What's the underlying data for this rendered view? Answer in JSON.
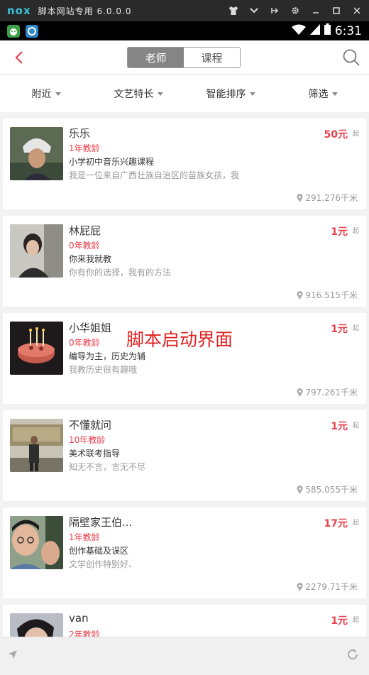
{
  "emulator": {
    "logo": "nox",
    "title": "脚本网站专用 6.0.0.0",
    "controls": [
      "shirt-icon",
      "chevron-down-icon",
      "pin-icon",
      "gear-icon",
      "minimize-icon",
      "maximize-icon",
      "close-icon"
    ]
  },
  "status_bar": {
    "time": "6:31"
  },
  "header": {
    "tabs": [
      {
        "label": "老师",
        "active": true
      },
      {
        "label": "课程",
        "active": false
      }
    ]
  },
  "filters": [
    {
      "label": "附近"
    },
    {
      "label": "文艺特长"
    },
    {
      "label": "智能排序"
    },
    {
      "label": "筛选"
    }
  ],
  "teachers": [
    {
      "name": "乐乐",
      "years": "1年教龄",
      "course": "小学初中音乐兴趣课程",
      "desc": "我是一位来自广西壮族自治区的苗族女孩，我",
      "price": "50元",
      "suffix": "起",
      "distance": "291.276千米"
    },
    {
      "name": "林屁屁",
      "years": "0年教龄",
      "course": "你来我就教",
      "desc": "你有你的选择，我有的方法",
      "price": "1元",
      "suffix": "起",
      "distance": "916.515千米"
    },
    {
      "name": "小华姐姐",
      "years": "0年教龄",
      "course": "编导为主，历史为辅",
      "desc": "我教历史很有趣哦",
      "price": "1元",
      "suffix": "起",
      "distance": "797.261千米"
    },
    {
      "name": "不懂就问",
      "years": "10年教龄",
      "course": "美术联考指导",
      "desc": "知无不言，言无不尽",
      "price": "1元",
      "suffix": "起",
      "distance": "585.055千米"
    },
    {
      "name": "隔壁家王伯...",
      "years": "1年教龄",
      "course": "创作基础及误区",
      "desc": "文学创作特别好、",
      "price": "17元",
      "suffix": "起",
      "distance": "2279.71千米"
    },
    {
      "name": "van",
      "years": "2年教龄",
      "course": "",
      "desc": "",
      "price": "1元",
      "suffix": "起",
      "distance": ""
    }
  ],
  "overlay_text": "脚本启动界面",
  "colors": {
    "accent": "#e8404b",
    "segment_active": "#858585"
  }
}
